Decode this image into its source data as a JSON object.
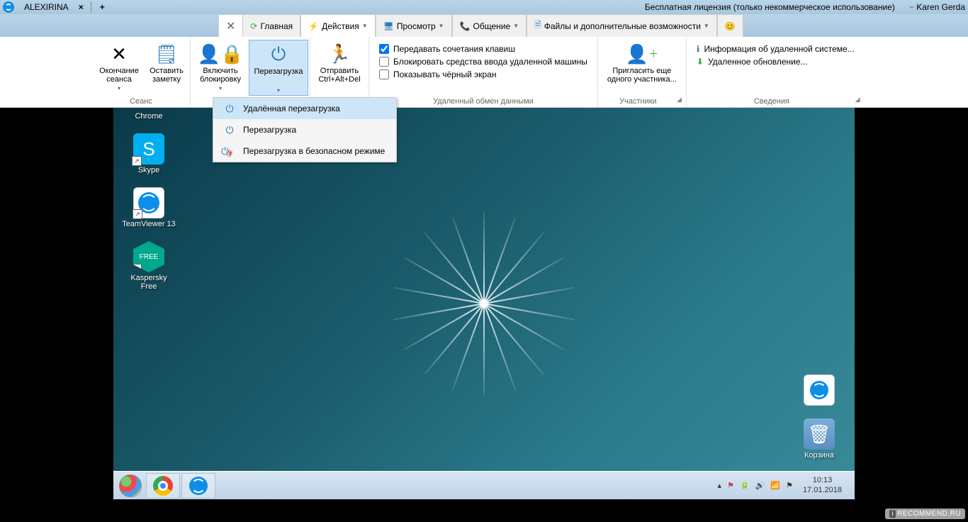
{
  "titlebar": {
    "tab_name": "ALEXIRINA",
    "license_text": "Бесплатная лицензия (только некоммерческое использование)",
    "user_name": "Karen Gerda"
  },
  "tabs": {
    "home": "Главная",
    "actions": "Действия",
    "view": "Просмотр",
    "comm": "Общение",
    "files": "Файлы и дополнительные возможности"
  },
  "ribbon": {
    "session": {
      "label": "Сеанс",
      "end_session": "Окончание сеанса",
      "note": "Оставить заметку"
    },
    "lock": "Включить блокировку",
    "reboot": "Перезагрузка",
    "cad": "Отправить Ctrl+Alt+Del",
    "checks": {
      "keys": "Передавать сочетания клавиш",
      "block": "Блокировать средства ввода удаленной машины",
      "black": "Показывать чёрный экран",
      "group": "Удаленный обмен данными"
    },
    "participants": {
      "invite": "Пригласить еще одного участника...",
      "group": "Участники"
    },
    "info": {
      "system": "Информация об удаленной системе...",
      "update": "Удаленное обновление...",
      "group": "Сведения"
    }
  },
  "dropdown": {
    "remote": "Удалённая перезагрузка",
    "reboot": "Перезагрузка",
    "safe": "Перезагрузка в безопасном режиме"
  },
  "desktop": {
    "chrome": "Chrome",
    "skype": "Skype",
    "teamviewer": "TeamViewer 13",
    "kaspersky": "Kaspersky Free",
    "recycle": "Корзина"
  },
  "tray": {
    "time": "10:13",
    "date": "17.01.2018"
  },
  "watermark": "RECOMMEND.RU"
}
